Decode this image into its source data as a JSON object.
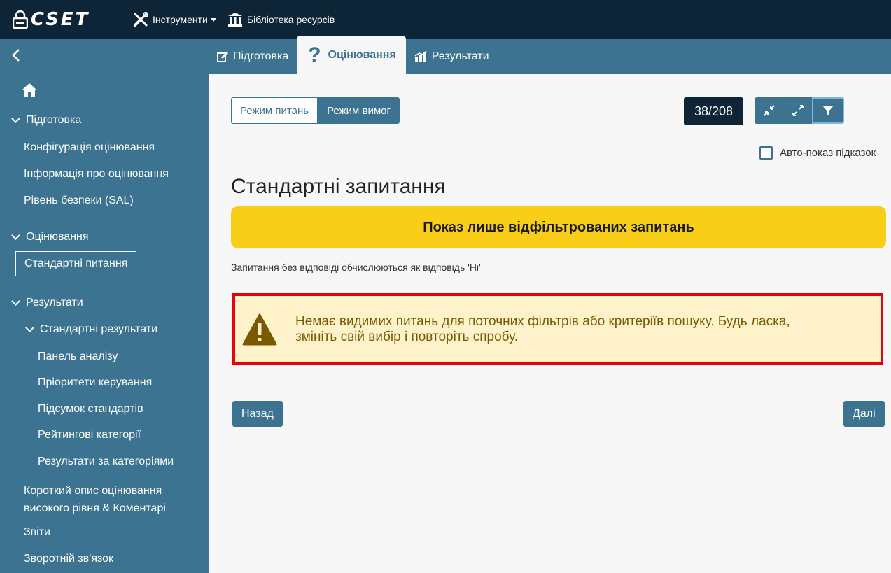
{
  "header": {
    "logo_text": "CSET",
    "tools_label": "Інструменти",
    "library_label": "Бібліотека ресурсів"
  },
  "tabs": [
    {
      "label": "Підготовка"
    },
    {
      "label": "Оцінювання",
      "active": true
    },
    {
      "label": "Результати"
    }
  ],
  "sidebar": {
    "prep_section": "Підготовка",
    "prep_items": [
      "Конфігурація оцінювання",
      "Інформація про оцінювання",
      "Рівень безпеки (SAL)"
    ],
    "assess_section": "Оцінювання",
    "assess_active": "Стандартні питання",
    "results_section": "Результати",
    "standard_results": "Стандартні результати",
    "results_items": [
      "Панель аналізу",
      "Пріоритети керування",
      "Підсумок стандартів",
      "Рейтингові категорії",
      "Результати за категоріями"
    ],
    "summary_line1": "Короткий опис оцінювання",
    "summary_line2": "високого рівня & Коментарі",
    "reports": "Звіти",
    "feedback": "Зворотній зв'язок"
  },
  "main": {
    "mode_questions": "Режим питань",
    "mode_requirements": "Режим вимог",
    "counter": "38/208",
    "auto_hints": "Авто-показ підказок",
    "page_title": "Стандартні запитання",
    "filter_banner": "Показ лише відфільтрованих запитань",
    "note": "Запитання без відповіді обчислюються як відповідь 'Ні'",
    "warning_line1": "Немає видимих питань для поточних фільтрів або критеріїв пошуку. Будь ласка,",
    "warning_line2": "змініть свій вибір і повторіть спробу.",
    "back_label": "Назад",
    "next_label": "Далі"
  },
  "colors": {
    "topbar": "#0d2536",
    "accent": "#3b7391",
    "banner": "#f8ce18",
    "warning_bg": "#fff3cc",
    "warning_border": "#e5020a"
  }
}
